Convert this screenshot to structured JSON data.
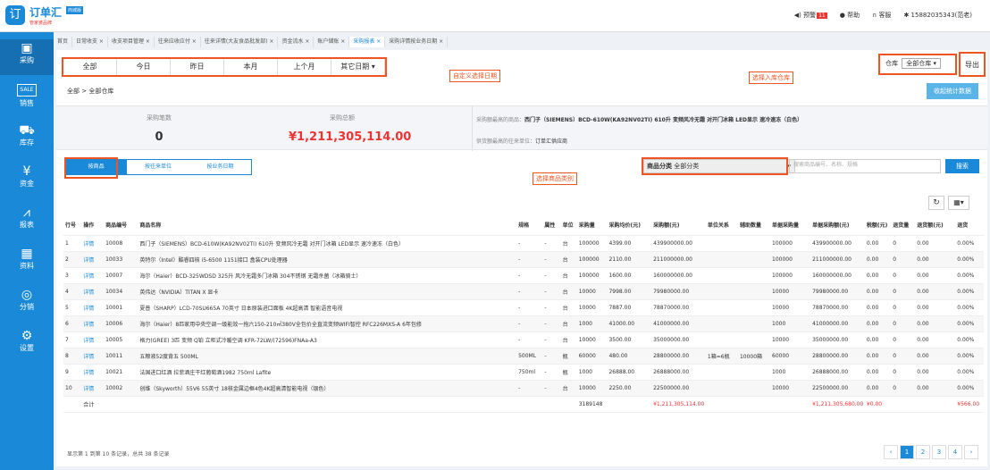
{
  "header": {
    "logo": "订单汇",
    "tag": "商城版",
    "sub": "管家婆品牌",
    "alert": "预警",
    "alert_count": "11",
    "help": "帮助",
    "service": "客服",
    "user": "15882035343(范老)"
  },
  "sidebar": [
    {
      "label": "采购",
      "icon": "▣"
    },
    {
      "label": "销售",
      "icon": "SALE"
    },
    {
      "label": "库存",
      "icon": "⛟"
    },
    {
      "label": "资金",
      "icon": "¥"
    },
    {
      "label": "报表",
      "icon": "⩘"
    },
    {
      "label": "资料",
      "icon": "▦"
    },
    {
      "label": "分销",
      "icon": "◎"
    },
    {
      "label": "设置",
      "icon": "⚙"
    }
  ],
  "tabs": [
    "首页",
    "日常收支 ×",
    "收支项目管理 ×",
    "往来应收应付 ×",
    "往来详情(大友食品批发部) ×",
    "资金流水 ×",
    "账户储账 ×",
    "采购报表 ×",
    "采购详情按业务日期 ×"
  ],
  "date_filters": [
    "全部",
    "今日",
    "昨日",
    "本月",
    "上个月",
    "其它日期 ▾"
  ],
  "annotations": {
    "custom_date": "自定义选择日期",
    "warehouse": "选择入库仓库",
    "category": "选择商品类别"
  },
  "warehouse": {
    "label": "仓库",
    "value": "全部仓库 ▾"
  },
  "export": "导出",
  "breadcrumb": "全部 > 全部仓库",
  "collapse": "收起统计数据",
  "stats": {
    "count_label": "采购笔数",
    "count": "0",
    "total_label": "采购总额",
    "total": "¥1,211,305,114.00",
    "top_product_label": "采购额最高的商品：",
    "top_product": "西门子（SIEMENS）BCD-610W(KA92NV02TI) 610升 变频风冷无霜 对开门冰箱 LED显示 速冷速冻（白色）",
    "top_supplier_label": "供货额最高的往来单位：",
    "top_supplier": "订单汇供应商"
  },
  "type_tabs": [
    "按商品",
    "按往来单位",
    "按业务日期"
  ],
  "category": {
    "label": "商品分类",
    "value": "全部分类"
  },
  "search": {
    "placeholder": "搜索商品编号、名称、规格",
    "button": "搜索"
  },
  "table": {
    "headers": [
      "行号",
      "操作",
      "商品编号",
      "商品名称",
      "规格",
      "属性",
      "单位",
      "采购量",
      "采购均价(元)",
      "采购额(元)",
      "单位关系",
      "辅助数量",
      "单据采购量",
      "单据采购额(元)",
      "税额(元)",
      "退货量",
      "退货额(元)",
      "退货"
    ],
    "rows": [
      [
        "1",
        "详情",
        "10008",
        "西门子（SIEMENS）BCD-610W(KA92NV02TI) 610升 变频风冷无霜 对开门冰箱 LED显示 速冷速冻（白色）",
        "-",
        "-",
        "台",
        "100000",
        "4399.00",
        "439900000.00",
        "",
        "",
        "100000",
        "439900000.00",
        "0.00",
        "0",
        "0.00",
        "0.00%"
      ],
      [
        "2",
        "详情",
        "10033",
        "英特尔（Intel）酷睿四核 i5-6500 1151接口 盒装CPU处理器",
        "-",
        "-",
        "台",
        "100000",
        "2110.00",
        "211000000.00",
        "",
        "",
        "100000",
        "211000000.00",
        "0.00",
        "0",
        "0.00",
        "0.00%"
      ],
      [
        "3",
        "详情",
        "10007",
        "海尔（Haier）BCD-325WDSD 325升 风冷无霜多门冰箱 304不锈钢 无霜杀菌（冰箱骑士）",
        "-",
        "-",
        "台",
        "100000",
        "1600.00",
        "160000000.00",
        "",
        "",
        "100000",
        "160000000.00",
        "0.00",
        "0",
        "0.00",
        "0.00%"
      ],
      [
        "4",
        "详情",
        "10034",
        "英伟达（NVIDIA）TITAN X 显卡",
        "-",
        "-",
        "台",
        "10000",
        "7998.00",
        "79980000.00",
        "",
        "",
        "10000",
        "79980000.00",
        "0.00",
        "0",
        "0.00",
        "0.00%"
      ],
      [
        "5",
        "详情",
        "10001",
        "夏普（SHARP）LCD-70SU665A 70英寸 日本原装进口面板 4K超高清 智能语音电视",
        "-",
        "-",
        "台",
        "10000",
        "7887.00",
        "78870000.00",
        "",
        "",
        "10000",
        "78870000.00",
        "0.00",
        "0",
        "0.00",
        "0.00%"
      ],
      [
        "6",
        "详情",
        "10006",
        "海尔（Haier）8匹家用中央空调一级能效一拖六150-210㎡380V全包价全直流变频WIFI智控 RFC226MXS-A 6年包修",
        "-",
        "-",
        "台",
        "1000",
        "41000.00",
        "41000000.00",
        "",
        "",
        "1000",
        "41000000.00",
        "0.00",
        "0",
        "0.00",
        "0.00%"
      ],
      [
        "7",
        "详情",
        "10005",
        "格力(GREE) 3匹 变频 Q铂 立柜式冷暖空调 KFR-72LW/(72596)FNAa-A3",
        "-",
        "-",
        "台",
        "10000",
        "3500.00",
        "35000000.00",
        "",
        "",
        "10000",
        "35000000.00",
        "0.00",
        "0",
        "0.00",
        "0.00%"
      ],
      [
        "8",
        "详情",
        "10011",
        "五粮液52度背五 500ML",
        "500ML",
        "-",
        "瓶",
        "60000",
        "480.00",
        "28800000.00",
        "1箱=6瓶",
        "10000箱",
        "60000",
        "28800000.00",
        "0.00",
        "0",
        "0.00",
        "0.00%"
      ],
      [
        "9",
        "详情",
        "10021",
        "法国进口红酒 拉菲酒庄干红葡萄酒1982 750ml Lafite",
        "750ml",
        "-",
        "瓶",
        "1000",
        "26888.00",
        "26888000.00",
        "",
        "",
        "1000",
        "26888000.00",
        "0.00",
        "0",
        "0.00",
        "0.00%"
      ],
      [
        "10",
        "详情",
        "10002",
        "创维（Skyworth）55V6 55英寸 18核金属边框4色4K超高清智能电视（银色）",
        "-",
        "-",
        "台",
        "10000",
        "2250.00",
        "22500000.00",
        "",
        "",
        "10000",
        "22500000.00",
        "0.00",
        "0",
        "0.00",
        "0.00%"
      ]
    ],
    "total": [
      "",
      "合计",
      "",
      "",
      "",
      "",
      "",
      "3189148",
      "",
      "¥1,211,305,114.00",
      "",
      "",
      "",
      "¥1,211,305,680.00",
      "¥0.00",
      "",
      "",
      "¥566.00"
    ]
  },
  "footer": "显示第 1 到第 10 条记录，总共 38 条记录",
  "pager": [
    "‹",
    "1",
    "2",
    "3",
    "4",
    "›"
  ]
}
